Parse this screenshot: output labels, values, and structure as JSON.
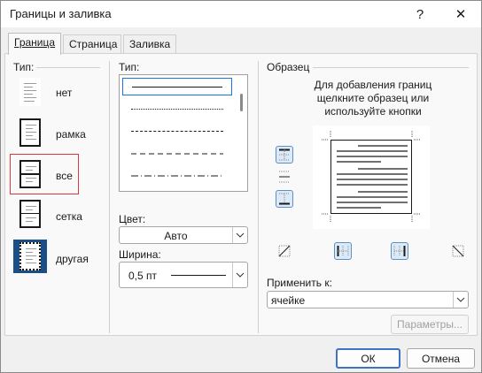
{
  "window": {
    "title": "Границы и заливка",
    "help_label": "?",
    "close_label": "✕"
  },
  "tabs": [
    {
      "label": "Граница",
      "active": true
    },
    {
      "label": "Страница",
      "active": false
    },
    {
      "label": "Заливка",
      "active": false
    }
  ],
  "setting": {
    "label": "Тип:",
    "options": [
      {
        "label": "нет",
        "icon": "border-none-icon"
      },
      {
        "label": "рамка",
        "icon": "border-box-icon"
      },
      {
        "label": "все",
        "icon": "border-all-icon",
        "selected": true
      },
      {
        "label": "сетка",
        "icon": "border-grid-icon"
      },
      {
        "label": "другая",
        "icon": "border-custom-icon"
      }
    ]
  },
  "style": {
    "label": "Тип:",
    "lines": [
      "solid",
      "dotted",
      "dashed-small",
      "dashed-medium",
      "dashed-dotted"
    ]
  },
  "color": {
    "label": "Цвет:",
    "value": "Авто"
  },
  "width": {
    "label": "Ширина:",
    "value": "0,5 пт"
  },
  "preview": {
    "label": "Образец",
    "instruction": "Для добавления границ щелкните образец или используйте кнопки"
  },
  "apply_to": {
    "label": "Применить к:",
    "value": "ячейке"
  },
  "buttons": {
    "options": "Параметры...",
    "ok": "ОК",
    "cancel": "Отмена"
  },
  "colors": {
    "accent": "#3b73c7",
    "selection": "#d9363e",
    "active_toggle": "#dceaf8"
  }
}
